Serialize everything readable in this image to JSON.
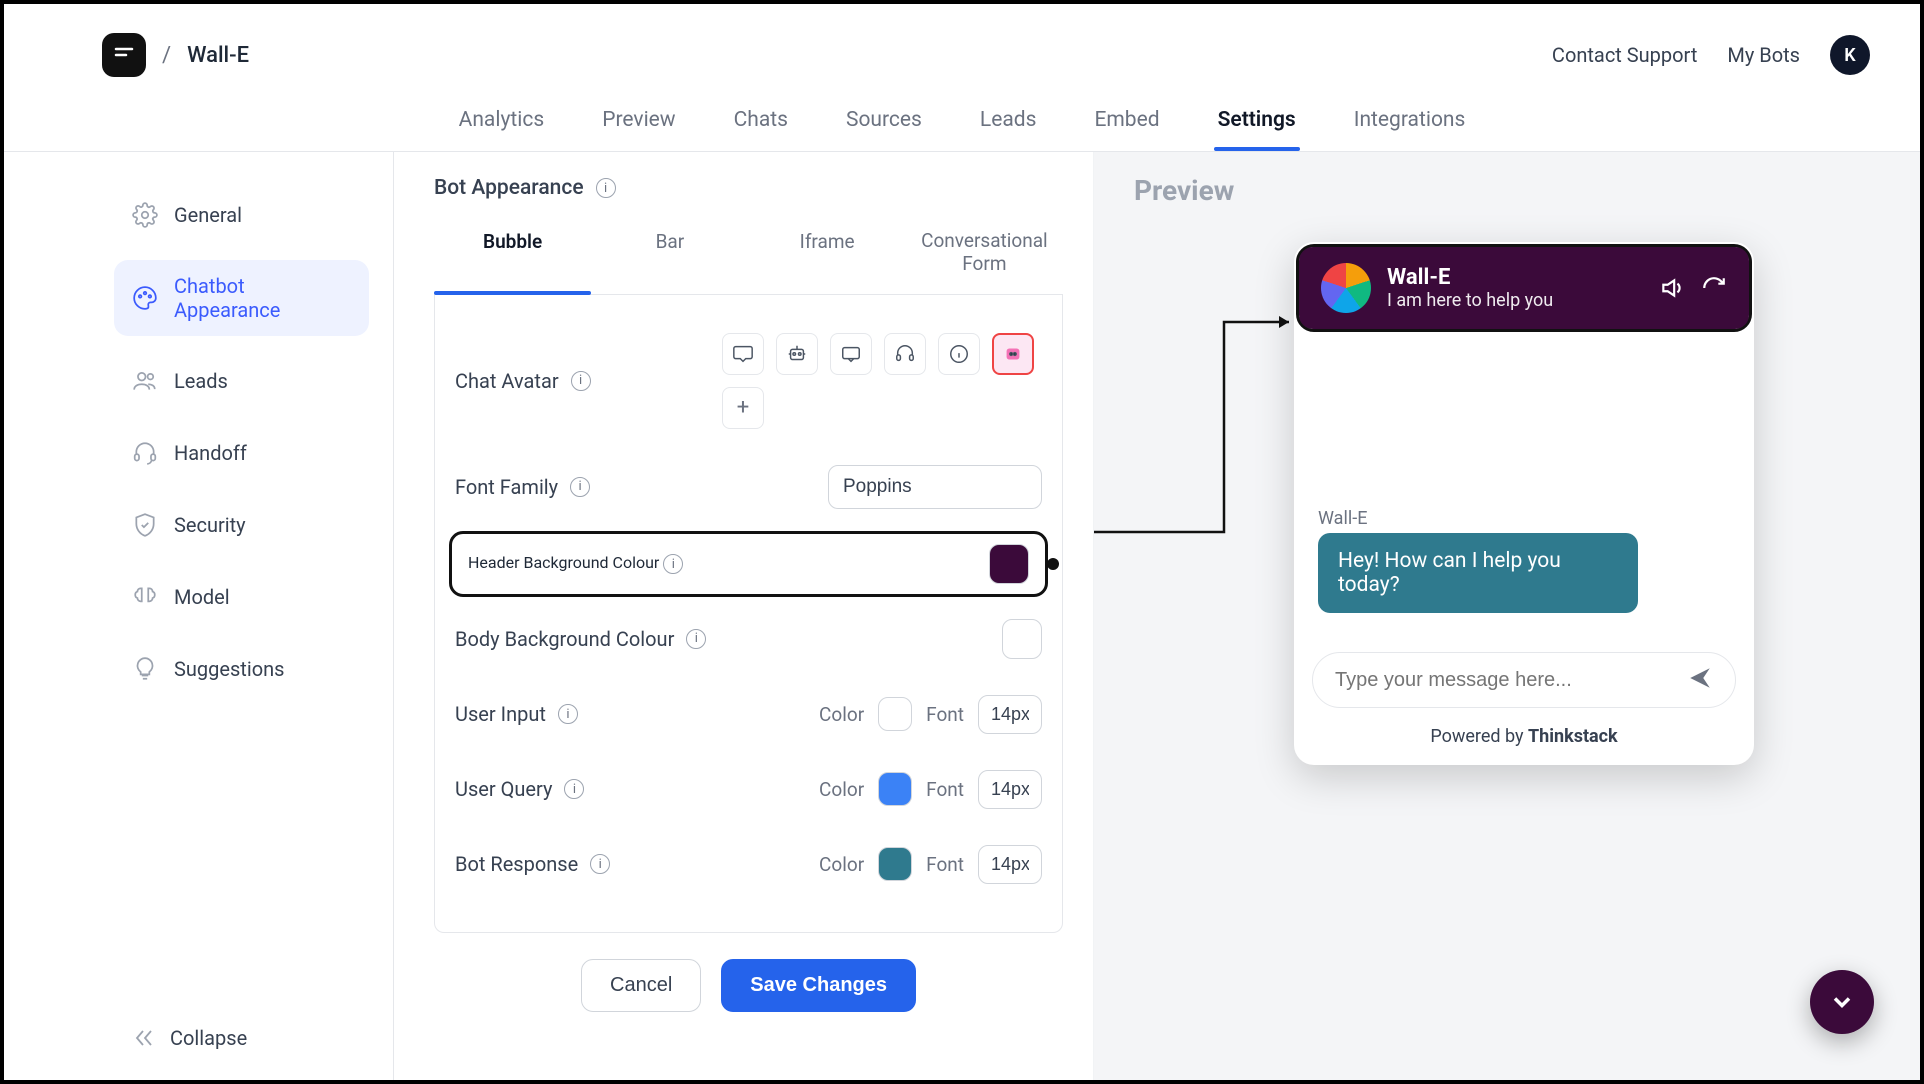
{
  "header": {
    "breadcrumb_title": "Wall-E",
    "links": {
      "support": "Contact Support",
      "mybots": "My Bots"
    },
    "avatar_initial": "K"
  },
  "tabs": [
    "Analytics",
    "Preview",
    "Chats",
    "Sources",
    "Leads",
    "Embed",
    "Settings",
    "Integrations"
  ],
  "tabs_active": "Settings",
  "sidebar": {
    "items": [
      {
        "label": "General"
      },
      {
        "label": "Chatbot Appearance"
      },
      {
        "label": "Leads"
      },
      {
        "label": "Handoff"
      },
      {
        "label": "Security"
      },
      {
        "label": "Model"
      },
      {
        "label": "Suggestions"
      }
    ],
    "active_index": 1,
    "collapse_label": "Collapse"
  },
  "editor": {
    "section_title": "Bot Appearance",
    "subtabs": [
      "Bubble",
      "Bar",
      "Iframe",
      "Conversational Form"
    ],
    "subtabs_active": "Bubble",
    "chat_avatar_label": "Chat Avatar",
    "font_family_label": "Font Family",
    "font_family_value": "Poppins",
    "header_bg_label": "Header Background Colour",
    "header_bg_color": "#3b0a3a",
    "body_bg_label": "Body Background Colour",
    "body_bg_color": "#ffffff",
    "user_input_label": "User Input",
    "user_query_label": "User Query",
    "bot_response_label": "Bot Response",
    "color_word": "Color",
    "font_word": "Font",
    "user_input_color": "#ffffff",
    "user_input_font": "14px",
    "user_query_color": "#3b82f6",
    "user_query_font": "14px",
    "bot_response_color": "#2f7a8e",
    "bot_response_font": "14px",
    "cancel_label": "Cancel",
    "save_label": "Save Changes"
  },
  "preview": {
    "title": "Preview",
    "bot_name": "Wall-E",
    "bot_tagline": "I am here to help you",
    "first_msg": "Hey! How can I help you today?",
    "input_placeholder": "Type your message here...",
    "powered_prefix": "Powered by ",
    "powered_brand": "Thinkstack"
  }
}
